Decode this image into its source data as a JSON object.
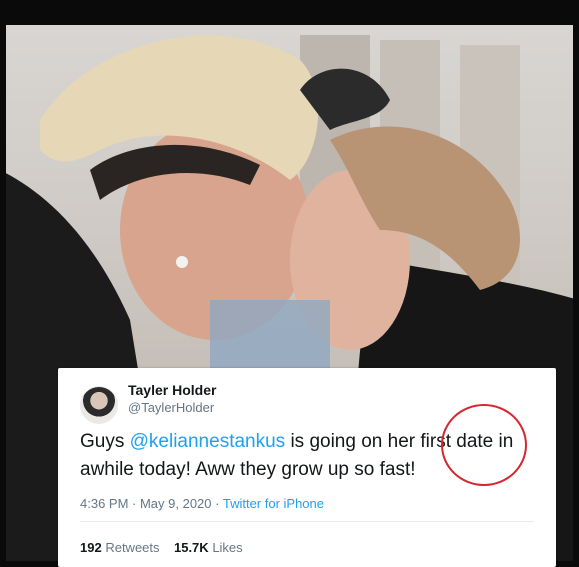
{
  "tweet": {
    "name": "Tayler Holder",
    "handle": "@TaylerHolder",
    "text_before": "Guys ",
    "mention": "@keliannestankus",
    "text_after": " is going on her first date in\nawhile today! Aww they grow up so fast!",
    "time": "4:36 PM · May 9, 2020",
    "separator": " · ",
    "source": "Twitter for iPhone",
    "retweets_count": "192",
    "retweets_label": "Retweets",
    "likes_count": "15.7K",
    "likes_label": "Likes"
  },
  "colors": {
    "link": "#1da1f2",
    "annotation_circle": "#d6262f"
  },
  "icons": {
    "avatar": "profile-photo"
  }
}
